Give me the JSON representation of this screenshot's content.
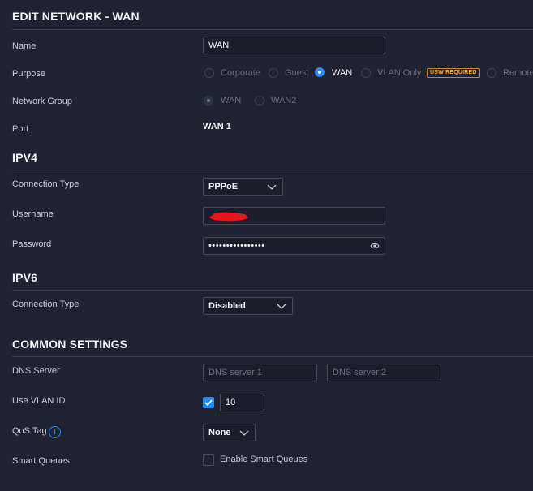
{
  "title": "EDIT NETWORK - WAN",
  "general": {
    "name_label": "Name",
    "name_value": "WAN",
    "purpose_label": "Purpose",
    "purpose_options": [
      "Corporate",
      "Guest",
      "WAN",
      "VLAN Only",
      "Remote"
    ],
    "purpose_selected": "WAN",
    "usw_badge": "USW REQUIRED",
    "network_group_label": "Network Group",
    "network_group_options": [
      "WAN",
      "WAN2"
    ],
    "network_group_selected": "WAN",
    "port_label": "Port",
    "port_value": "WAN 1"
  },
  "ipv4": {
    "title": "IPV4",
    "connection_type_label": "Connection Type",
    "connection_type_value": "PPPoE",
    "username_label": "Username",
    "password_label": "Password",
    "password_value": "••••••••••••••••"
  },
  "ipv6": {
    "title": "IPV6",
    "connection_type_label": "Connection Type",
    "connection_type_value": "Disabled"
  },
  "common": {
    "title": "COMMON SETTINGS",
    "dns_label": "DNS Server",
    "dns1_placeholder": "DNS server 1",
    "dns2_placeholder": "DNS server 2",
    "vlan_label": "Use VLAN ID",
    "vlan_checked": true,
    "vlan_value": "10",
    "qos_label": "QoS Tag",
    "qos_value": "None",
    "smart_queues_label": "Smart Queues",
    "smart_queues_checkbox_label": "Enable Smart Queues",
    "smart_queues_checked": false
  },
  "colors": {
    "background": "#1f2230",
    "accent": "#2a8bf2",
    "badge": "#f0a63a",
    "redaction": "#e8141c"
  },
  "icons": [
    "eye-icon",
    "chevron-down-icon",
    "check-icon",
    "info-icon"
  ]
}
